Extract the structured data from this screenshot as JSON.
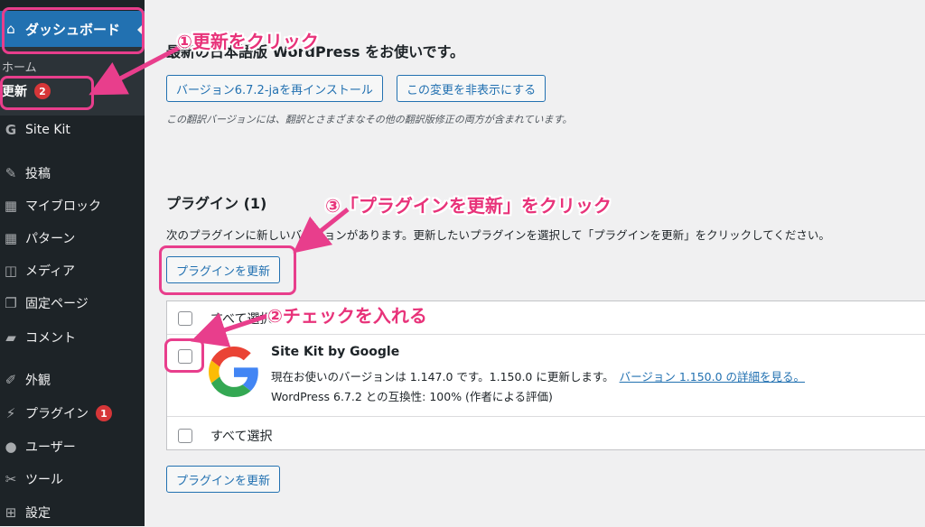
{
  "sidebar": {
    "dashboard_label": "ダッシュボード",
    "home_label": "ホーム",
    "update_label": "更新",
    "update_count": "2",
    "items": [
      {
        "label": "Site Kit",
        "icon": "G"
      },
      {
        "label": "投稿",
        "icon": "📌"
      },
      {
        "label": "マイブロック",
        "icon": "▦"
      },
      {
        "label": "パターン",
        "icon": "▦"
      },
      {
        "label": "メディア",
        "icon": "🖾"
      },
      {
        "label": "固定ページ",
        "icon": "❐"
      },
      {
        "label": "コメント",
        "icon": "💬"
      },
      {
        "label": "外観",
        "icon": "🖌"
      },
      {
        "label": "プラグイン",
        "icon": "🔌",
        "badge": "1"
      },
      {
        "label": "ユーザー",
        "icon": "👤"
      },
      {
        "label": "ツール",
        "icon": "🔧"
      },
      {
        "label": "設定",
        "icon": "⊞"
      }
    ]
  },
  "main": {
    "translation_heading": "最新の日本語版 WordPress をお使いです。",
    "reinstall_button": "バージョン6.7.2-jaを再インストール",
    "hide_button": "この変更を非表示にする",
    "translation_note": "この翻訳バージョンには、翻訳とさまざまなその他の翻訳版修正の両方が含まれています。",
    "plugins_heading": "プラグイン (1)",
    "plugins_desc": "次のプラグインに新しいバージョンがあります。更新したいプラグインを選択して「プラグインを更新」をクリックしてください。",
    "update_plugins_button": "プラグインを更新",
    "select_all": "すべて選択",
    "plugin": {
      "name": "Site Kit by Google",
      "version_text": "現在お使いのバージョンは 1.147.0 です。1.150.0 に更新します。",
      "details_link": "バージョン 1.150.0 の詳細を見る。",
      "compat_text": "WordPress 6.7.2 との互換性: 100% (作者による評価)"
    }
  },
  "annotations": {
    "step1": "①更新をクリック",
    "step2": "②チェックを入れる",
    "step3": "③「プラグインを更新」をクリック"
  },
  "colors": {
    "accent": "#2271b1",
    "sidebar_bg": "#1d2327",
    "annotation": "#e83e8c",
    "badge": "#d63638"
  }
}
